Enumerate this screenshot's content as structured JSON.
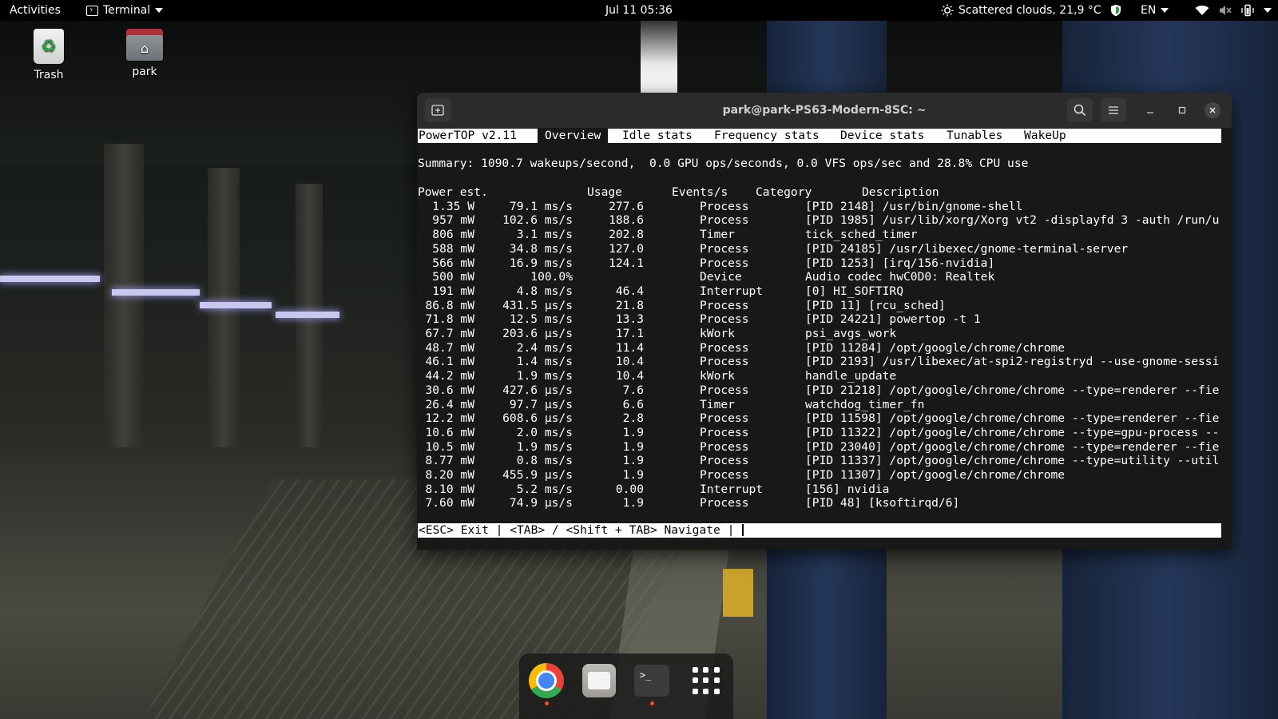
{
  "topbar": {
    "activities": "Activities",
    "app_menu": "Terminal",
    "clock": "Jul 11  05:36",
    "weather": "Scattered clouds, 21,9 °C",
    "language": "EN"
  },
  "desktop": {
    "icons": [
      {
        "label": "Trash"
      },
      {
        "label": "park"
      }
    ]
  },
  "window": {
    "title": "park@park-PS63-Modern-8SC: ~"
  },
  "powertop": {
    "version": "PowerTOP v2.11",
    "tabs": [
      "Overview",
      "Idle stats",
      "Frequency stats",
      "Device stats",
      "Tunables",
      "WakeUp"
    ],
    "selected_tab": "Overview",
    "summary": "Summary: 1090.7 wakeups/second,  0.0 GPU ops/seconds, 0.0 VFS ops/sec and 28.8% CPU use",
    "headers": {
      "power": "Power est.",
      "usage": "Usage",
      "events": "Events/s",
      "category": "Category",
      "description": "Description"
    },
    "rows": [
      {
        "power": "1.35 W",
        "usage": "79.1 ms/s",
        "events": "277.6",
        "category": "Process",
        "description": "[PID 2148] /usr/bin/gnome-shell"
      },
      {
        "power": "957 mW",
        "usage": "102.6 ms/s",
        "events": "188.6",
        "category": "Process",
        "description": "[PID 1985] /usr/lib/xorg/Xorg vt2 -displayfd 3 -auth /run/u"
      },
      {
        "power": "806 mW",
        "usage": "3.1 ms/s",
        "events": "202.8",
        "category": "Timer",
        "description": "tick_sched_timer"
      },
      {
        "power": "588 mW",
        "usage": "34.8 ms/s",
        "events": "127.0",
        "category": "Process",
        "description": "[PID 24185] /usr/libexec/gnome-terminal-server"
      },
      {
        "power": "566 mW",
        "usage": "16.9 ms/s",
        "events": "124.1",
        "category": "Process",
        "description": "[PID 1253] [irq/156-nvidia]"
      },
      {
        "power": "500 mW",
        "usage": "100.0%",
        "events": "",
        "category": "Device",
        "description": "Audio codec hwC0D0: Realtek"
      },
      {
        "power": "191 mW",
        "usage": "4.8 ms/s",
        "events": "46.4",
        "category": "Interrupt",
        "description": "[0] HI_SOFTIRQ"
      },
      {
        "power": "86.8 mW",
        "usage": "431.5 µs/s",
        "events": "21.8",
        "category": "Process",
        "description": "[PID 11] [rcu_sched]"
      },
      {
        "power": "71.8 mW",
        "usage": "12.5 ms/s",
        "events": "13.3",
        "category": "Process",
        "description": "[PID 24221] powertop -t 1"
      },
      {
        "power": "67.7 mW",
        "usage": "203.6 µs/s",
        "events": "17.1",
        "category": "kWork",
        "description": "psi_avgs_work"
      },
      {
        "power": "48.7 mW",
        "usage": "2.4 ms/s",
        "events": "11.4",
        "category": "Process",
        "description": "[PID 11284] /opt/google/chrome/chrome"
      },
      {
        "power": "46.1 mW",
        "usage": "1.4 ms/s",
        "events": "10.4",
        "category": "Process",
        "description": "[PID 2193] /usr/libexec/at-spi2-registryd --use-gnome-sessi"
      },
      {
        "power": "44.2 mW",
        "usage": "1.9 ms/s",
        "events": "10.4",
        "category": "kWork",
        "description": "handle_update"
      },
      {
        "power": "30.6 mW",
        "usage": "427.6 µs/s",
        "events": "7.6",
        "category": "Process",
        "description": "[PID 21218] /opt/google/chrome/chrome --type=renderer --fie"
      },
      {
        "power": "26.4 mW",
        "usage": "97.7 µs/s",
        "events": "6.6",
        "category": "Timer",
        "description": "watchdog_timer_fn"
      },
      {
        "power": "12.2 mW",
        "usage": "608.6 µs/s",
        "events": "2.8",
        "category": "Process",
        "description": "[PID 11598] /opt/google/chrome/chrome --type=renderer --fie"
      },
      {
        "power": "10.6 mW",
        "usage": "2.0 ms/s",
        "events": "1.9",
        "category": "Process",
        "description": "[PID 11322] /opt/google/chrome/chrome --type=gpu-process --"
      },
      {
        "power": "10.5 mW",
        "usage": "1.9 ms/s",
        "events": "1.9",
        "category": "Process",
        "description": "[PID 23040] /opt/google/chrome/chrome --type=renderer --fie"
      },
      {
        "power": "8.77 mW",
        "usage": "0.8 ms/s",
        "events": "1.9",
        "category": "Process",
        "description": "[PID 11337] /opt/google/chrome/chrome --type=utility --util"
      },
      {
        "power": "8.20 mW",
        "usage": "455.9 µs/s",
        "events": "1.9",
        "category": "Process",
        "description": "[PID 11307] /opt/google/chrome/chrome"
      },
      {
        "power": "8.10 mW",
        "usage": "5.2 ms/s",
        "events": "0.00",
        "category": "Interrupt",
        "description": "[156] nvidia"
      },
      {
        "power": "7.60 mW",
        "usage": "74.9 µs/s",
        "events": "1.9",
        "category": "Process",
        "description": "[PID 48] [ksoftirqd/6]"
      }
    ],
    "footer": "<ESC> Exit | <TAB> / <Shift + TAB> Navigate |"
  },
  "dock": {
    "items": [
      {
        "icon": "chrome-icon",
        "running": true
      },
      {
        "icon": "files-icon",
        "running": false
      },
      {
        "icon": "terminal-icon",
        "running": true
      },
      {
        "icon": "app-grid-icon",
        "running": false
      }
    ]
  }
}
